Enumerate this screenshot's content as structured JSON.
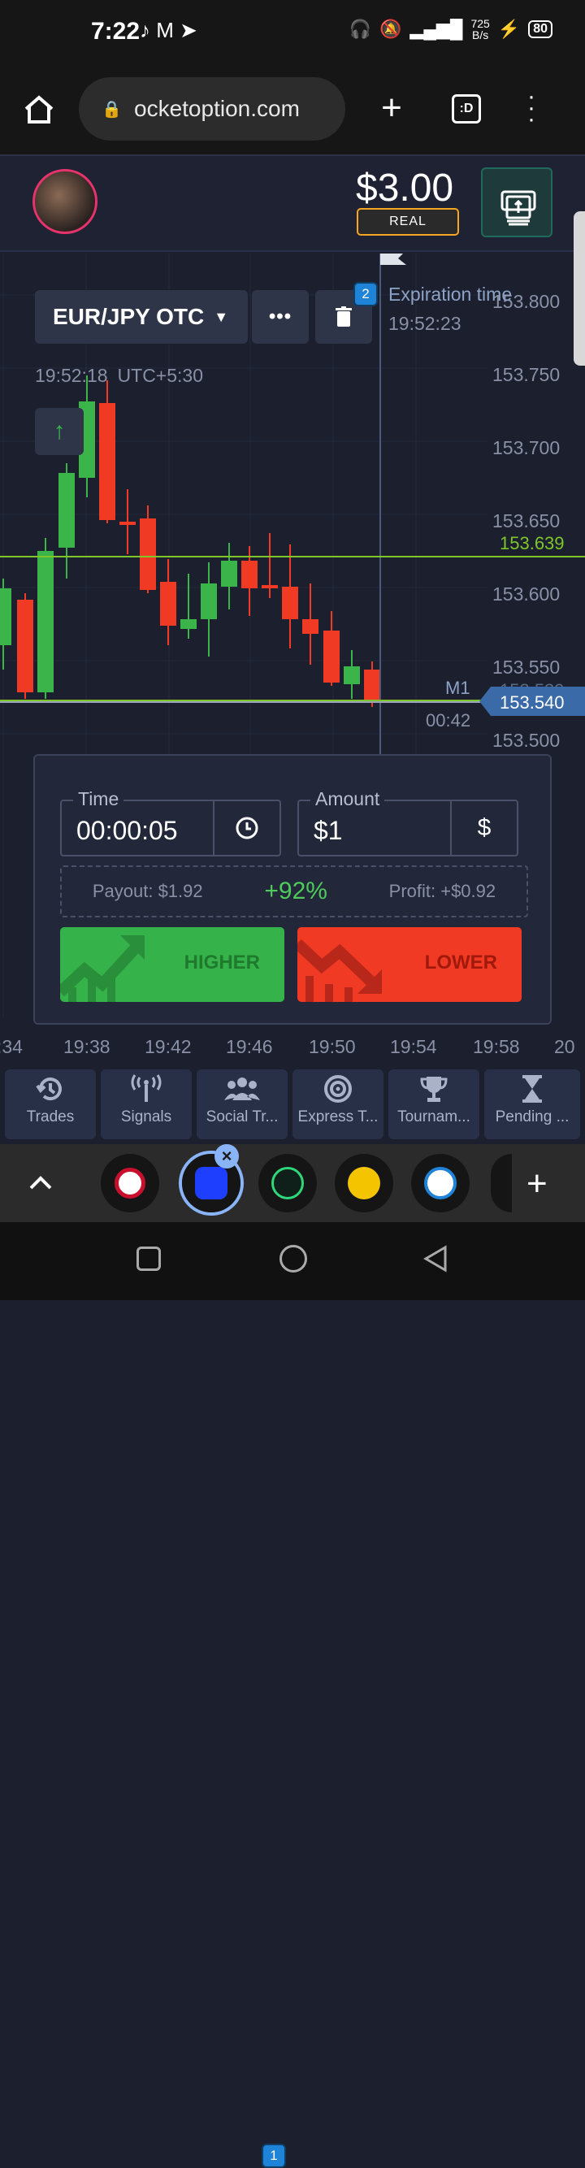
{
  "status": {
    "time": "7:22",
    "notifications": "♪ M ➤",
    "speed_top": "725",
    "speed_unit": "B/s",
    "battery": "80"
  },
  "browser": {
    "url": "ocketoption.com",
    "tab_label": ":D"
  },
  "account": {
    "balance": "$3.00",
    "mode": "REAL"
  },
  "asset": {
    "pair": "EUR/JPY OTC",
    "badge": "2"
  },
  "expiration": {
    "label": "Expiration time",
    "time": "19:52:23"
  },
  "clock": {
    "time": "19:52:18",
    "tz": "UTC+5:30"
  },
  "price_axis": [
    "153.800",
    "153.750",
    "153.700",
    "153.650",
    "153.600",
    "153.550",
    "153.500"
  ],
  "lines": {
    "resistance": "153.639",
    "current": "153.540",
    "hidden": "153.539"
  },
  "timeframe": "M1",
  "countdown": "00:42",
  "time_axis": [
    ":34",
    "19:38",
    "19:42",
    "19:46",
    "19:50",
    "19:54",
    "19:58",
    "20"
  ],
  "trade": {
    "time_label": "Time",
    "time_value": "00:00:05",
    "amount_label": "Amount",
    "amount_value": "$1",
    "currency_symbol": "$",
    "payout": "Payout: $1.92",
    "percent": "+92%",
    "profit": "Profit: +$0.92",
    "higher": "HIGHER",
    "lower": "LOWER"
  },
  "tabs": [
    {
      "label": "Trades",
      "icon": "history-icon"
    },
    {
      "label": "Signals",
      "icon": "signal-icon"
    },
    {
      "label": "Social Tr...",
      "icon": "users-icon",
      "badge": "1"
    },
    {
      "label": "Express T...",
      "icon": "target-icon"
    },
    {
      "label": "Tournam...",
      "icon": "trophy-icon"
    },
    {
      "label": "Pending ...",
      "icon": "hourglass-icon"
    }
  ],
  "colors": {
    "up": "#3bb54a",
    "down": "#f03a24",
    "accent_line": "#7ec629",
    "bg": "#1b1f2e"
  }
}
